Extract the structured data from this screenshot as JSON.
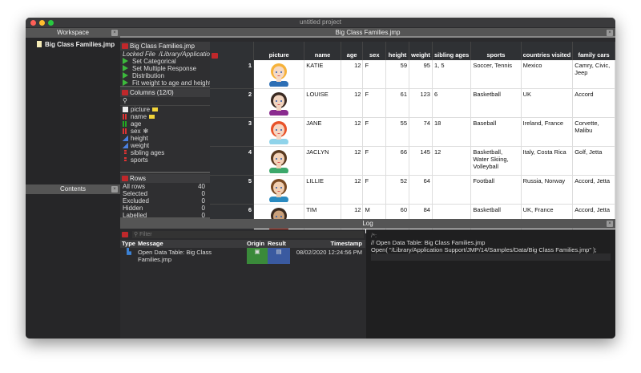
{
  "window": {
    "title": "untitled project"
  },
  "workspace": {
    "title": "Workspace",
    "items": [
      "Big Class Families.jmp"
    ]
  },
  "contents": {
    "title": "Contents"
  },
  "doc_tab": {
    "title": "Big Class Families.jmp"
  },
  "table_panel": {
    "title": "Big Class Families.jmp",
    "locked": "Locked File",
    "path": "/Library/Application",
    "scripts": [
      "Set Categorical",
      "Set Multiple Response",
      "Distribution",
      "Fit weight to age and height"
    ]
  },
  "columns_panel": {
    "title": "Columns (12/0)",
    "items": [
      {
        "name": "picture",
        "type": "picture",
        "tag": true
      },
      {
        "name": "name",
        "type": "nominal",
        "tag": true
      },
      {
        "name": "age",
        "type": "ordinal"
      },
      {
        "name": "sex",
        "type": "nominal",
        "asterisk": "✻"
      },
      {
        "name": "height",
        "type": "continuous"
      },
      {
        "name": "weight",
        "type": "continuous"
      },
      {
        "name": "sibling ages",
        "type": "multiple"
      },
      {
        "name": "sports",
        "type": "multiple"
      }
    ]
  },
  "rows_panel": {
    "title": "Rows",
    "items": [
      {
        "label": "All rows",
        "value": "40"
      },
      {
        "label": "Selected",
        "value": "0"
      },
      {
        "label": "Excluded",
        "value": "0"
      },
      {
        "label": "Hidden",
        "value": "0"
      },
      {
        "label": "Labelled",
        "value": "0"
      }
    ]
  },
  "grid": {
    "headers": [
      "picture",
      "name",
      "age",
      "sex",
      "height",
      "weight",
      "sibling ages",
      "sports",
      "countries visited",
      "family cars"
    ],
    "rows": [
      {
        "n": "1",
        "hair": "#f6b23a",
        "skin": "#f5d9c6",
        "shirt": "#2e6fb5",
        "name": "KATIE",
        "age": "12",
        "sex": "F",
        "height": "59",
        "weight": "95",
        "siblings": "1, 5",
        "sports": "Soccer, Tennis",
        "countries": "Mexico",
        "cars": "Camry, Civic, Jeep"
      },
      {
        "n": "2",
        "hair": "#3a2a22",
        "skin": "#f1d4bf",
        "shirt": "#8a2b8f",
        "name": "LOUISE",
        "age": "12",
        "sex": "F",
        "height": "61",
        "weight": "123",
        "siblings": "6",
        "sports": "Basketball",
        "countries": "UK",
        "cars": "Accord"
      },
      {
        "n": "3",
        "hair": "#e8532a",
        "skin": "#f6d6c2",
        "shirt": "#8fd3ea",
        "name": "JANE",
        "age": "12",
        "sex": "F",
        "height": "55",
        "weight": "74",
        "siblings": "18",
        "sports": "Baseball",
        "countries": "Ireland, France",
        "cars": "Corvette, Malibu"
      },
      {
        "n": "4",
        "hair": "#5a3a20",
        "skin": "#f3d2b8",
        "shirt": "#3ca86b",
        "name": "JACLYN",
        "age": "12",
        "sex": "F",
        "height": "66",
        "weight": "145",
        "siblings": "12",
        "sports": "Basketball, Water Skiing, Volleyball",
        "countries": "Italy, Costa Rica",
        "cars": "Golf, Jetta"
      },
      {
        "n": "5",
        "hair": "#7a4a22",
        "skin": "#f1cfb2",
        "shirt": "#2a8ac0",
        "name": "LILLIE",
        "age": "12",
        "sex": "F",
        "height": "52",
        "weight": "64",
        "siblings": "",
        "sports": "Football",
        "countries": "Russia, Norway",
        "cars": "Accord, Jetta"
      },
      {
        "n": "6",
        "hair": "#3b2a1e",
        "skin": "#caa07a",
        "shirt": "#c0392b",
        "name": "TIM",
        "age": "12",
        "sex": "M",
        "height": "60",
        "weight": "84",
        "siblings": "",
        "sports": "Basketball",
        "countries": "UK, France",
        "cars": "Accord, Jetta"
      }
    ]
  },
  "log": {
    "title": "Log",
    "filter_placeholder": "Filter",
    "headers": [
      "Type",
      "Message",
      "Origin",
      "Result",
      "Timestamp"
    ],
    "entries": [
      {
        "message": "Open Data Table: Big Class Families.jmp",
        "timestamp": "08/02/2020 12:24:56 PM"
      }
    ],
    "script": [
      "/*:",
      "// Open Data Table: Big Class Families.jmp",
      "Open( \"/Library/Application Support/JMP/14/Samples/Data/Big Class Families.jmp\" );"
    ]
  }
}
